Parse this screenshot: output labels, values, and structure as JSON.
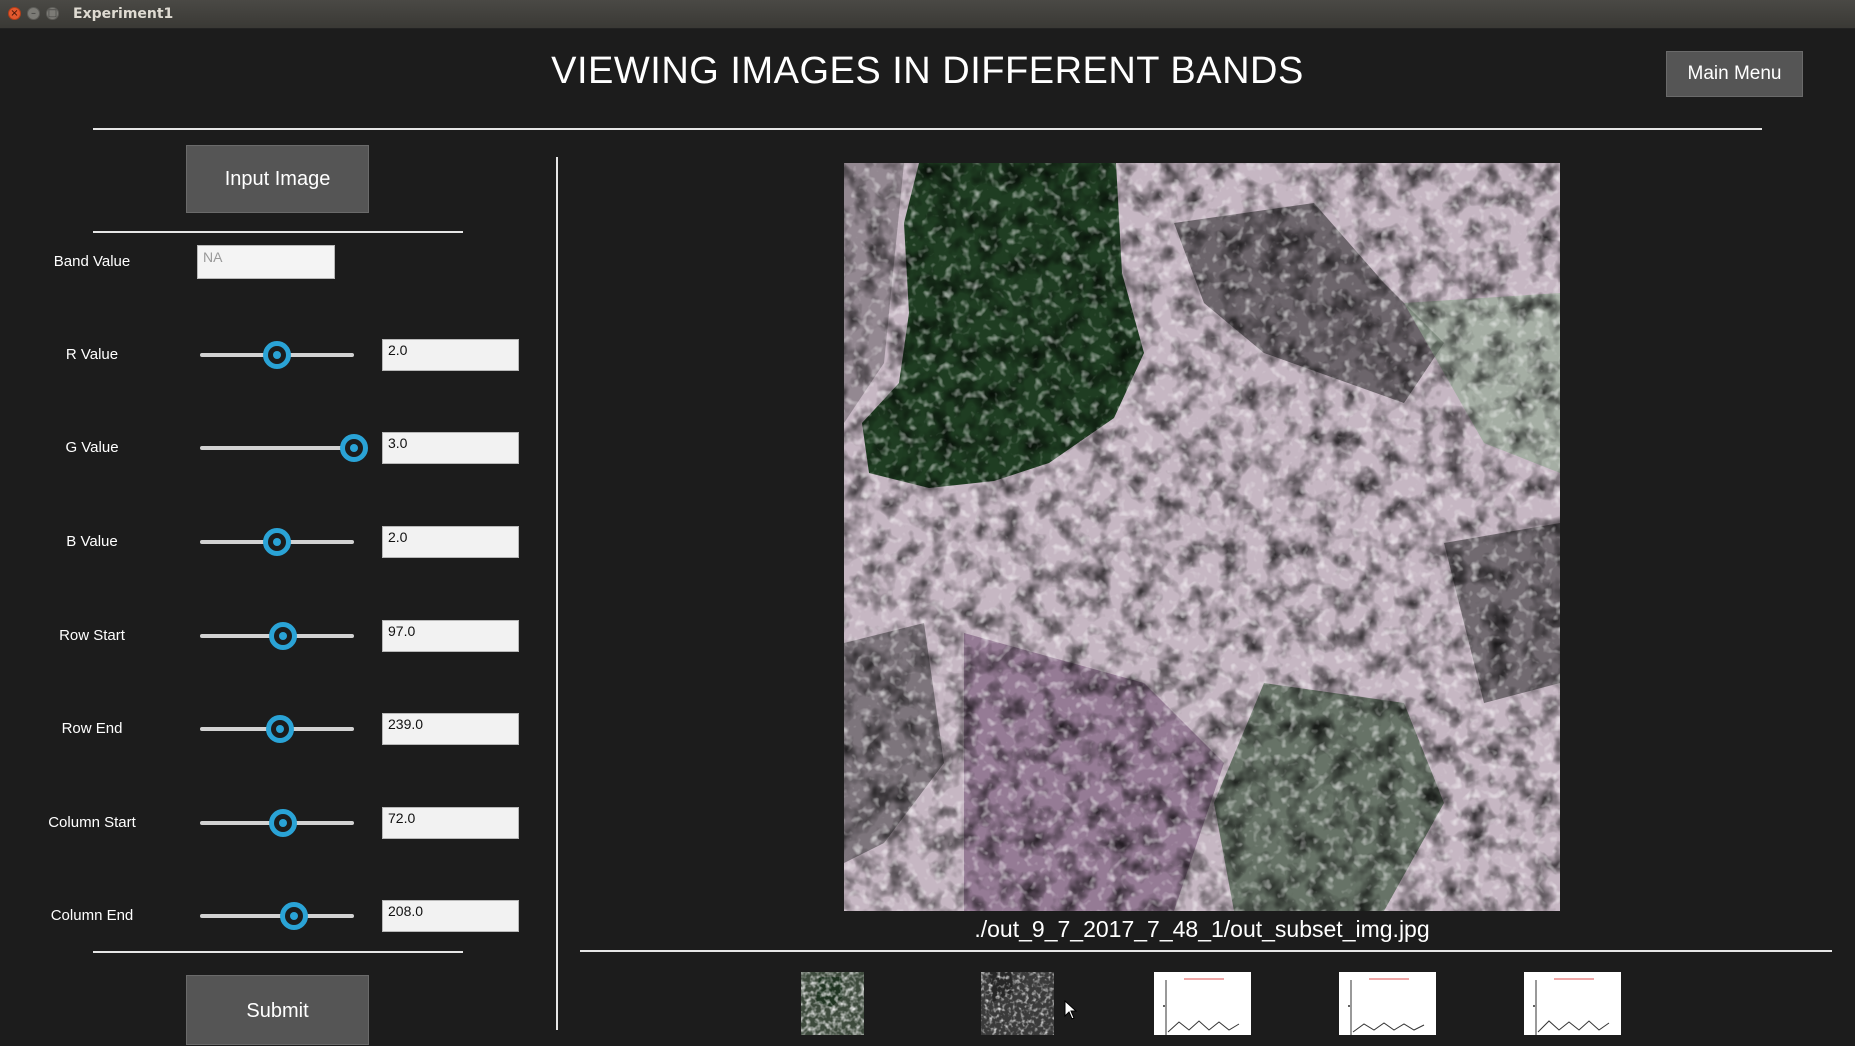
{
  "window": {
    "title": "Experiment1"
  },
  "header": {
    "title": "VIEWING IMAGES IN DIFFERENT BANDS",
    "main_menu_label": "Main Menu"
  },
  "controls": {
    "input_image_label": "Input Image",
    "band": {
      "label": "Band Value",
      "placeholder": "NA"
    },
    "sliders": [
      {
        "label": "R Value",
        "value": "2.0",
        "level": 0.5
      },
      {
        "label": "G Value",
        "value": "3.0",
        "level": 1.0
      },
      {
        "label": "B Value",
        "value": "2.0",
        "level": 0.5
      },
      {
        "label": "Row Start",
        "value": "97.0",
        "level": 0.54
      },
      {
        "label": "Row End",
        "value": "239.0",
        "level": 0.52
      },
      {
        "label": "Column Start",
        "value": "72.0",
        "level": 0.54
      },
      {
        "label": "Column End",
        "value": "208.0",
        "level": 0.61
      }
    ],
    "submit_label": "Submit"
  },
  "image": {
    "caption": "./out_9_7_2017_7_48_1/out_subset_img.jpg"
  },
  "colors": {
    "background": "#1c1c1c",
    "button": "#555555",
    "slider_accent": "#2aa3d6"
  }
}
